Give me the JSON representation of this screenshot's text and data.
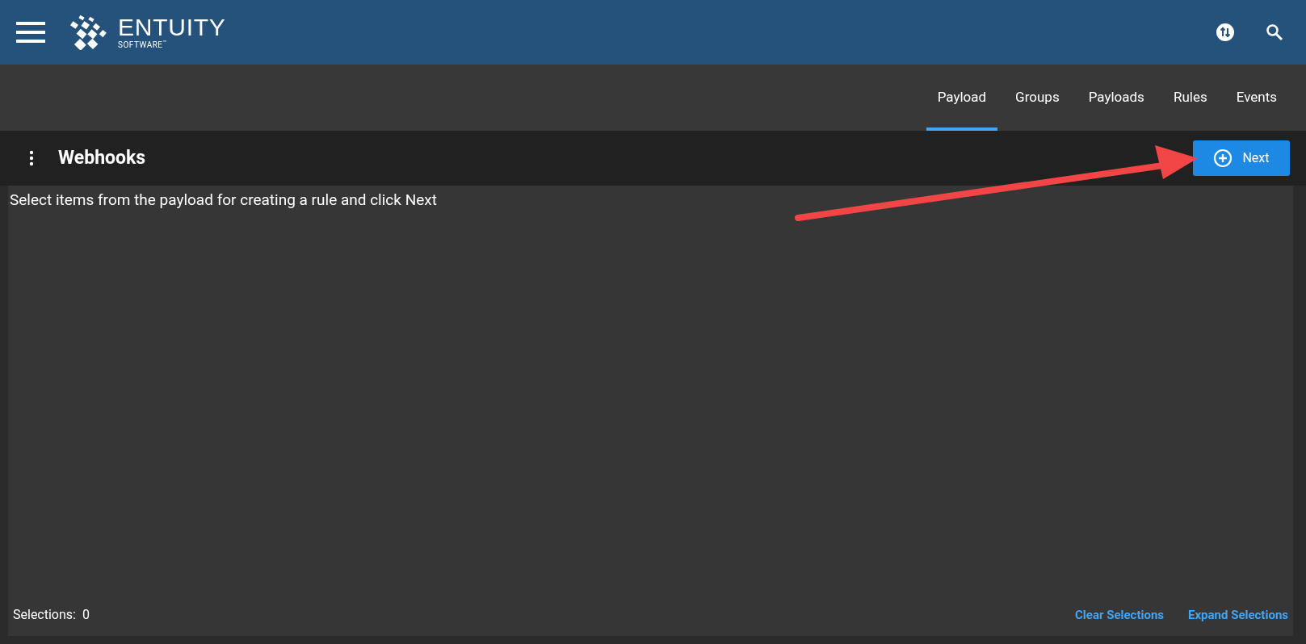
{
  "header": {
    "logo": {
      "name": "ENTUITY",
      "sub": "SOFTWARE",
      "mark": "™"
    }
  },
  "tabs": [
    {
      "label": "Payload",
      "selected": true
    },
    {
      "label": "Groups",
      "selected": false
    },
    {
      "label": "Payloads",
      "selected": false
    },
    {
      "label": "Rules",
      "selected": false
    },
    {
      "label": "Events",
      "selected": false
    }
  ],
  "panel": {
    "title": "Webhooks",
    "next_button": "Next",
    "instruction": "Select items from the payload for creating a rule and click Next"
  },
  "footer": {
    "selections_label": "Selections:",
    "selections_count": "0",
    "links": [
      "Clear Selections",
      "Expand Selections"
    ]
  },
  "annotation": {
    "kind": "arrow"
  }
}
